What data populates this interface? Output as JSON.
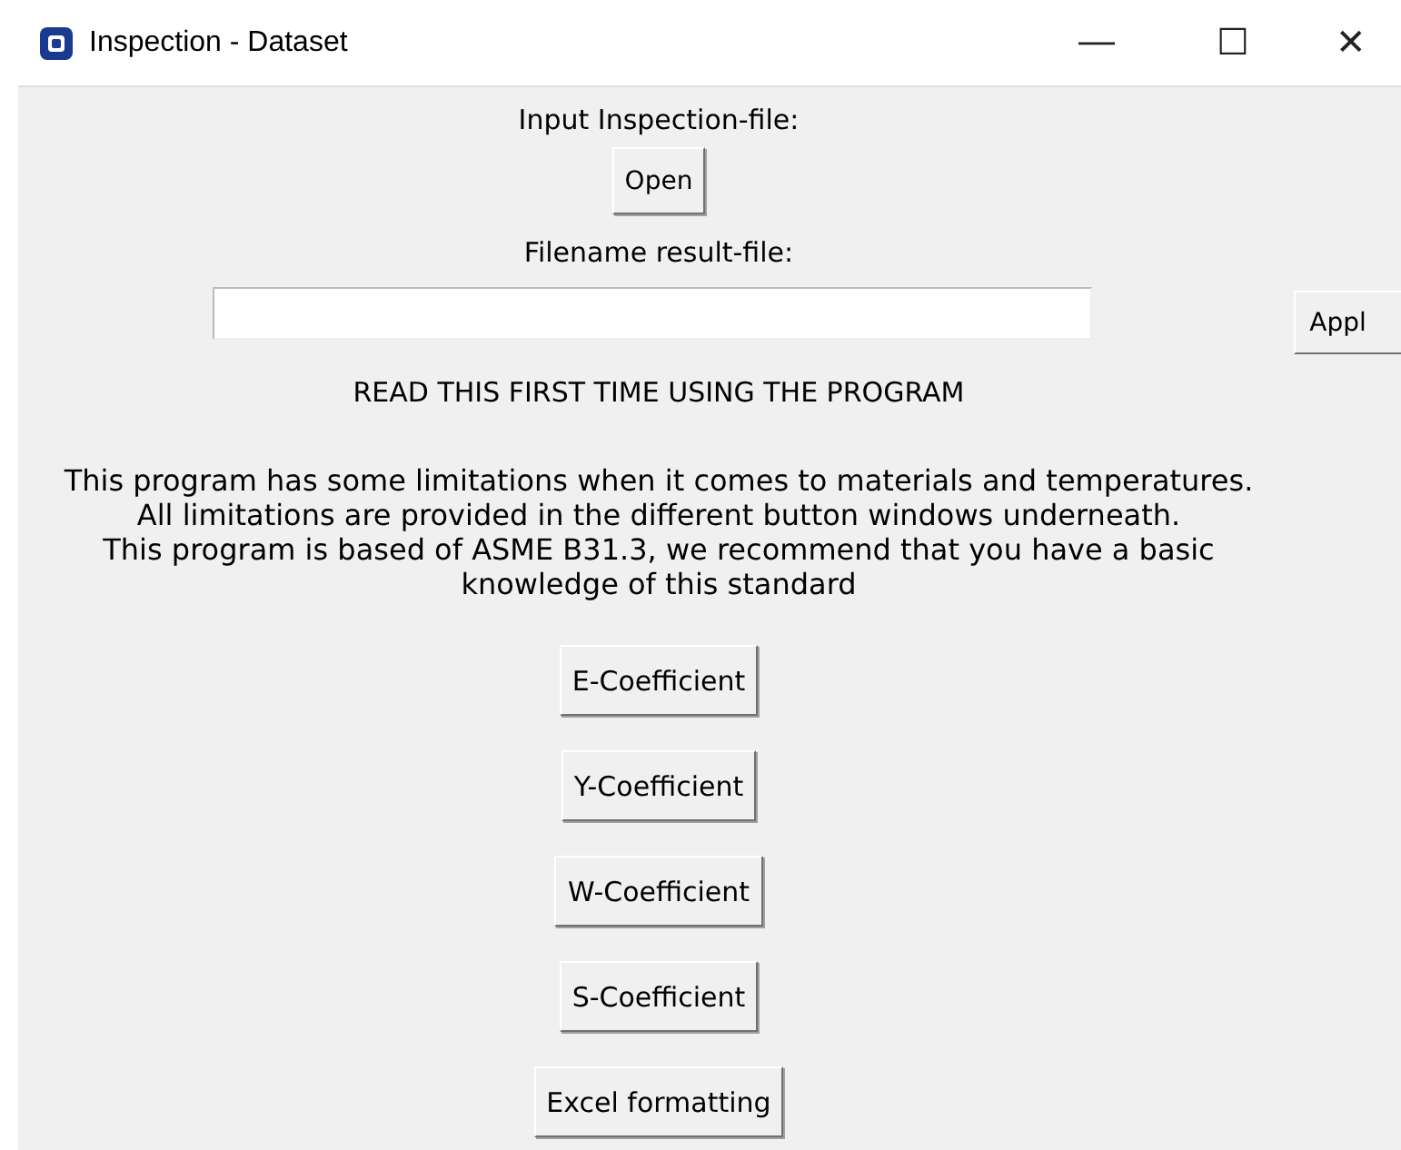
{
  "window": {
    "title": "Inspection - Dataset",
    "controls": [
      "—",
      "☐",
      "✕"
    ]
  },
  "input_label": "Input Inspection-file:",
  "open_button": "Open",
  "result_label": "Filename result-file:",
  "apply_button": "Appl",
  "heading": "READ THIS FIRST TIME USING THE PROGRAM",
  "notice": [
    "This program has some limitations when it comes to materials and temperatures.",
    "All limitations are provided in the different button windows underneath.",
    "This program is based of ASME B31.3, we recommend that you have a basic",
    "knowledge of this standard"
  ],
  "buttons": [
    "E-Coefficient",
    "Y-Coefficient",
    "W-Coefficient",
    "S-Coefficient",
    "Excel formatting"
  ]
}
